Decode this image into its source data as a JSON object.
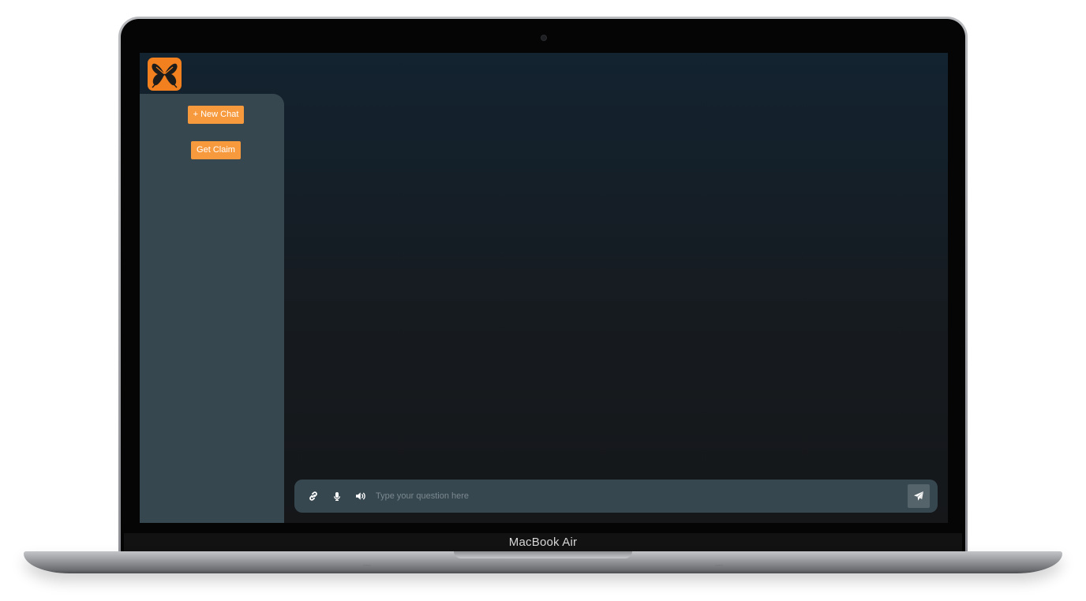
{
  "device": {
    "brand_label": "MacBook Air"
  },
  "app": {
    "logo_icon": "butterfly-icon",
    "colors": {
      "accent": "#f79a3e",
      "logo_bg": "#f2801f",
      "sidebar_bg": "#37474f",
      "screen_bg_top": "#132330",
      "screen_bg_bottom": "#151719"
    },
    "sidebar": {
      "new_chat_label": "+ New Chat",
      "get_claim_label": "Get Claim"
    },
    "composer": {
      "attach_icon": "link-icon",
      "mic_icon": "microphone-icon",
      "speaker_icon": "speaker-icon",
      "send_icon": "paper-plane-icon",
      "input_value": "",
      "placeholder": "Type your question here"
    }
  }
}
